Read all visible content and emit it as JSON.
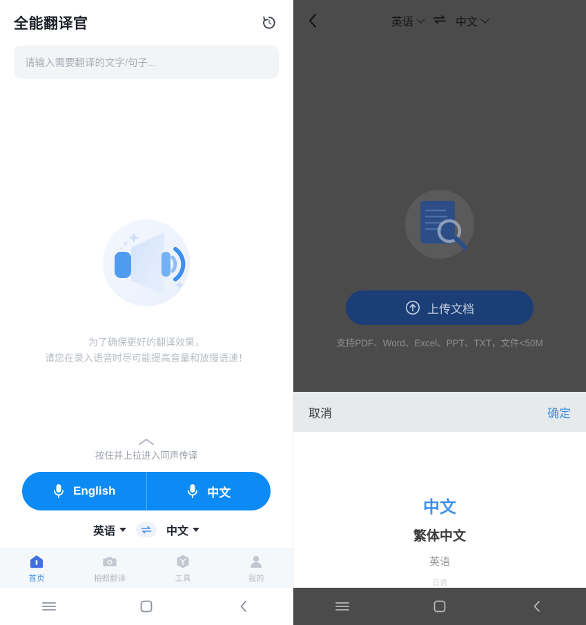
{
  "left": {
    "title": "全能翻译官",
    "history_icon": "history-clock-icon",
    "search": {
      "placeholder": "请输入需要翻译的文字/句子..."
    },
    "hero": {
      "illustration": "megaphone-speaker-icon",
      "hint_line1": "为了确保更好的翻译效果，",
      "hint_line2": "请您在录入语音时尽可能提高音量和放慢语速！"
    },
    "pull": {
      "chevron_icon": "chevron-up-icon",
      "hint": "按住并上拉进入同声传译"
    },
    "mic_buttons": [
      {
        "label": "English",
        "icon": "microphone-icon"
      },
      {
        "label": "中文",
        "icon": "microphone-icon"
      }
    ],
    "lang_row": {
      "source": "英语",
      "target": "中文",
      "swap_icon": "swap-arrows-icon"
    },
    "tabs": [
      {
        "label": "首页",
        "icon": "home-icon",
        "active": true
      },
      {
        "label": "拍照翻译",
        "icon": "camera-icon",
        "active": false
      },
      {
        "label": "工具",
        "icon": "toolbox-cube-icon",
        "active": false
      },
      {
        "label": "我的",
        "icon": "user-profile-icon",
        "active": false
      }
    ]
  },
  "right": {
    "header": {
      "back_icon": "back-chevron-icon",
      "source": "英语",
      "target": "中文",
      "swap_icon": "swap-arrows-icon"
    },
    "document": {
      "illustration": "document-magnifier-icon",
      "upload_label": "上传文档",
      "upload_icon": "upload-circle-arrow-icon",
      "support_text": "支持PDF、Word、Excel、PPT、TXT，文件<50M"
    },
    "action_bar": {
      "cancel": "取消",
      "confirm": "确定"
    },
    "picker": {
      "options": [
        "中文",
        "繁体中文",
        "英语",
        "日语"
      ],
      "selected": "中文"
    }
  },
  "system_nav": {
    "menu_icon": "menu-hamburger-icon",
    "home_icon": "home-square-icon",
    "back_icon": "back-chevron-icon"
  },
  "colors": {
    "accent_blue": "#0c8bf5",
    "picker_blue": "#3e92e8",
    "overlay_gray": "#4b4b4b",
    "upload_navy": "#1b3e77",
    "action_bar_bg": "#e7eaec"
  }
}
